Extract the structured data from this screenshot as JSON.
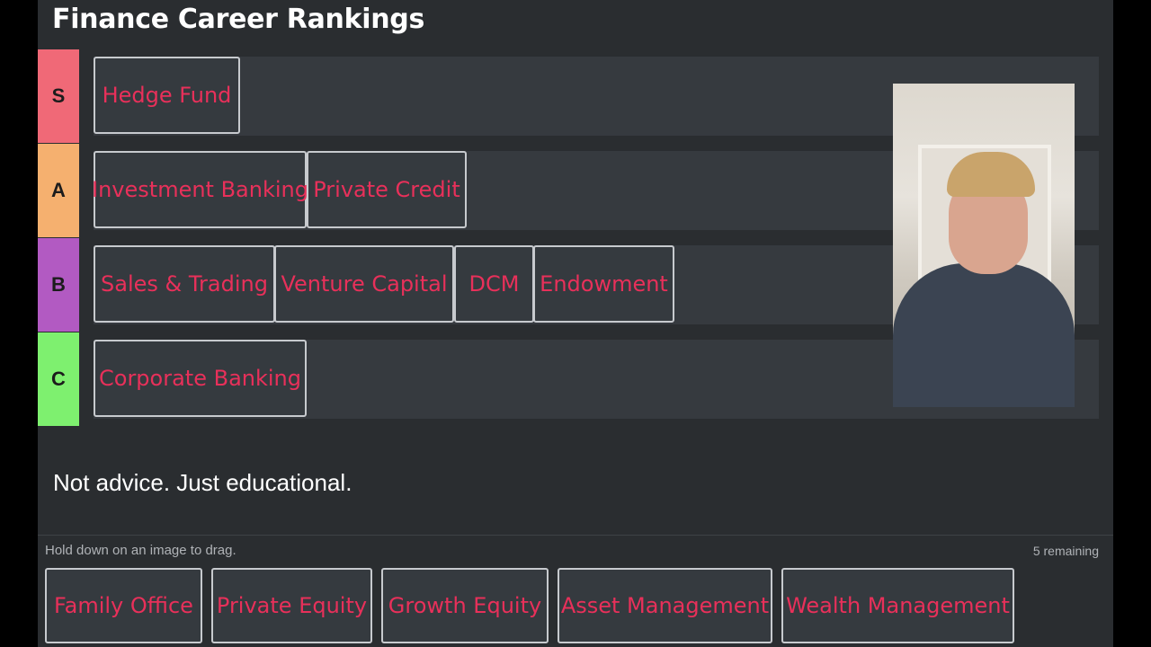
{
  "title": "Finance Career Rankings",
  "tiers": [
    {
      "label": "S",
      "color": "#f06977",
      "items": [
        "Hedge Fund"
      ]
    },
    {
      "label": "A",
      "color": "#f5b06f",
      "items": [
        "Investment Banking",
        "Private Credit"
      ]
    },
    {
      "label": "B",
      "color": "#b25ac2",
      "items": [
        "Sales & Trading",
        "Venture Capital",
        "DCM",
        "Endowment"
      ]
    },
    {
      "label": "C",
      "color": "#7ef06f",
      "items": [
        "Corporate Banking"
      ]
    }
  ],
  "caption": "Not advice. Just educational.",
  "pool": {
    "hint": "Hold down on an image to drag.",
    "remaining": "5 remaining",
    "items": [
      "Family Office",
      "Private Equity",
      "Growth Equity",
      "Asset Management",
      "Wealth Management"
    ]
  },
  "colors": {
    "card_text": "#e8305a",
    "card_border": "#c7cace",
    "background": "#2a2d30"
  }
}
